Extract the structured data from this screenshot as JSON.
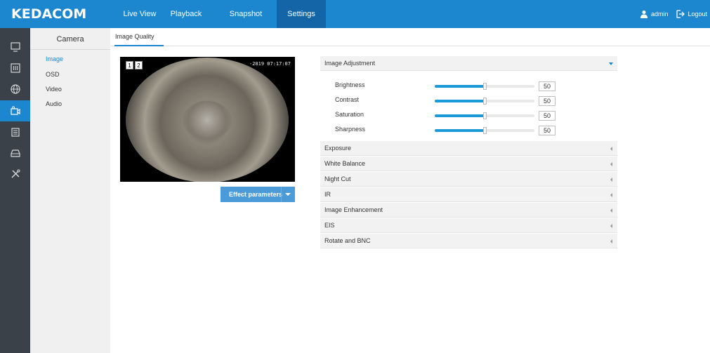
{
  "brand": {
    "name": "KEDACOM"
  },
  "topnav": [
    "Live View",
    "Playback",
    "Snapshot",
    "Settings"
  ],
  "user": {
    "name": "admin",
    "logout_label": "Logout"
  },
  "rail_icons": [
    "monitor-icon",
    "equalizer-icon",
    "network-globe-icon",
    "camera-icon",
    "event-calendar-icon",
    "storage-icon",
    "tools-icon"
  ],
  "subnav": {
    "title": "Camera",
    "items": [
      "Image",
      "OSD",
      "Video",
      "Audio"
    ]
  },
  "tab": {
    "label": "Image Quality"
  },
  "preview": {
    "btn1": "1",
    "btn2": "2",
    "timestamp": "-2019 07:17:07"
  },
  "effect_button": {
    "label": "Effect parameters"
  },
  "image_adjustment": {
    "title": "Image Adjustment",
    "sliders": [
      {
        "label": "Brightness",
        "value": "50",
        "fraction": 0.5
      },
      {
        "label": "Contrast",
        "value": "50",
        "fraction": 0.5
      },
      {
        "label": "Saturation",
        "value": "50",
        "fraction": 0.5
      },
      {
        "label": "Sharpness",
        "value": "50",
        "fraction": 0.5
      }
    ]
  },
  "sections": [
    "Exposure",
    "White Balance",
    "Night Cut",
    "IR",
    "Image Enhancement",
    "EIS",
    "Rotate and BNC"
  ],
  "colors": {
    "topbar": "#1c87cf",
    "active_nav": "#1365a8",
    "sidebar": "#3b4148",
    "accent": "#1a9ad6"
  }
}
